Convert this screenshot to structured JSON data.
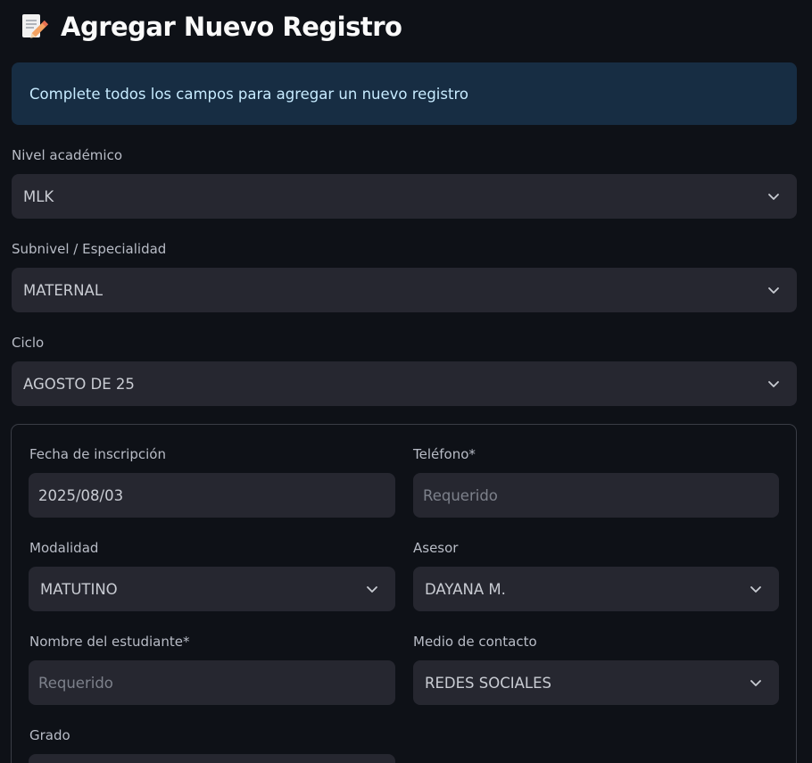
{
  "header": {
    "icon": "memo-pencil-icon",
    "title": "Agregar Nuevo Registro"
  },
  "info": {
    "message": "Complete todos los campos para agregar un nuevo registro"
  },
  "fields": {
    "nivel": {
      "label": "Nivel académico",
      "value": "MLK"
    },
    "subnivel": {
      "label": "Subnivel / Especialidad",
      "value": "MATERNAL"
    },
    "ciclo": {
      "label": "Ciclo",
      "value": "AGOSTO DE 25"
    }
  },
  "form": {
    "fecha": {
      "label": "Fecha de inscripción",
      "value": "2025/08/03"
    },
    "telefono": {
      "label": "Teléfono*",
      "placeholder": "Requerido"
    },
    "modalidad": {
      "label": "Modalidad",
      "value": "MATUTINO"
    },
    "asesor": {
      "label": "Asesor",
      "value": "DAYANA M."
    },
    "nombre": {
      "label": "Nombre del estudiante*",
      "placeholder": "Requerido"
    },
    "medio": {
      "label": "Medio de contacto",
      "value": "REDES SOCIALES"
    },
    "grado": {
      "label": "Grado"
    }
  },
  "colors": {
    "background": "#0e1117",
    "info_background": "#172d43",
    "info_text": "#c7ebff",
    "field_background": "#262730"
  }
}
